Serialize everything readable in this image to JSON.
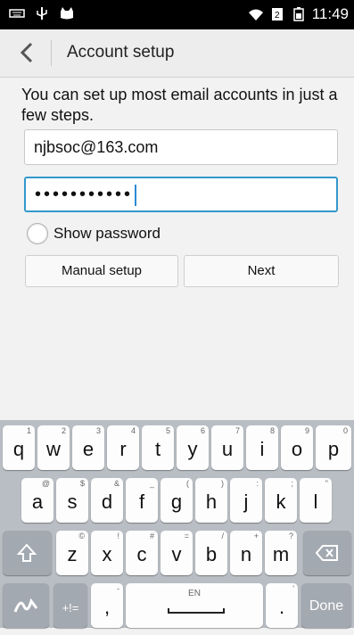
{
  "status": {
    "time": "11:49"
  },
  "header": {
    "title": "Account setup"
  },
  "main": {
    "intro": "You can set up most email accounts in just a few steps.",
    "email_value": "njbsoc@163.com",
    "password_mask": "•••••••••••",
    "show_password_label": "Show password",
    "manual_setup_label": "Manual setup",
    "next_label": "Next"
  },
  "keyboard": {
    "row1": [
      {
        "key": "q",
        "hint": "1"
      },
      {
        "key": "w",
        "hint": "2"
      },
      {
        "key": "e",
        "hint": "3"
      },
      {
        "key": "r",
        "hint": "4"
      },
      {
        "key": "t",
        "hint": "5"
      },
      {
        "key": "y",
        "hint": "6"
      },
      {
        "key": "u",
        "hint": "7"
      },
      {
        "key": "i",
        "hint": "8"
      },
      {
        "key": "o",
        "hint": "9"
      },
      {
        "key": "p",
        "hint": "0"
      }
    ],
    "row2": [
      {
        "key": "a",
        "hint": "@"
      },
      {
        "key": "s",
        "hint": "$"
      },
      {
        "key": "d",
        "hint": "&"
      },
      {
        "key": "f",
        "hint": "_"
      },
      {
        "key": "g",
        "hint": "("
      },
      {
        "key": "h",
        "hint": ")"
      },
      {
        "key": "j",
        "hint": ":"
      },
      {
        "key": "k",
        "hint": ";"
      },
      {
        "key": "l",
        "hint": "\""
      }
    ],
    "row3": [
      {
        "key": "z",
        "hint": "©"
      },
      {
        "key": "x",
        "hint": "!"
      },
      {
        "key": "c",
        "hint": "#"
      },
      {
        "key": "v",
        "hint": "="
      },
      {
        "key": "b",
        "hint": "/"
      },
      {
        "key": "n",
        "hint": "+"
      },
      {
        "key": "m",
        "hint": "?"
      }
    ],
    "symbols_label": "+!=",
    "comma": ",",
    "space_label": "EN",
    "period": ".",
    "period_hint": "'",
    "comma_hint": "-",
    "done_label": "Done"
  }
}
